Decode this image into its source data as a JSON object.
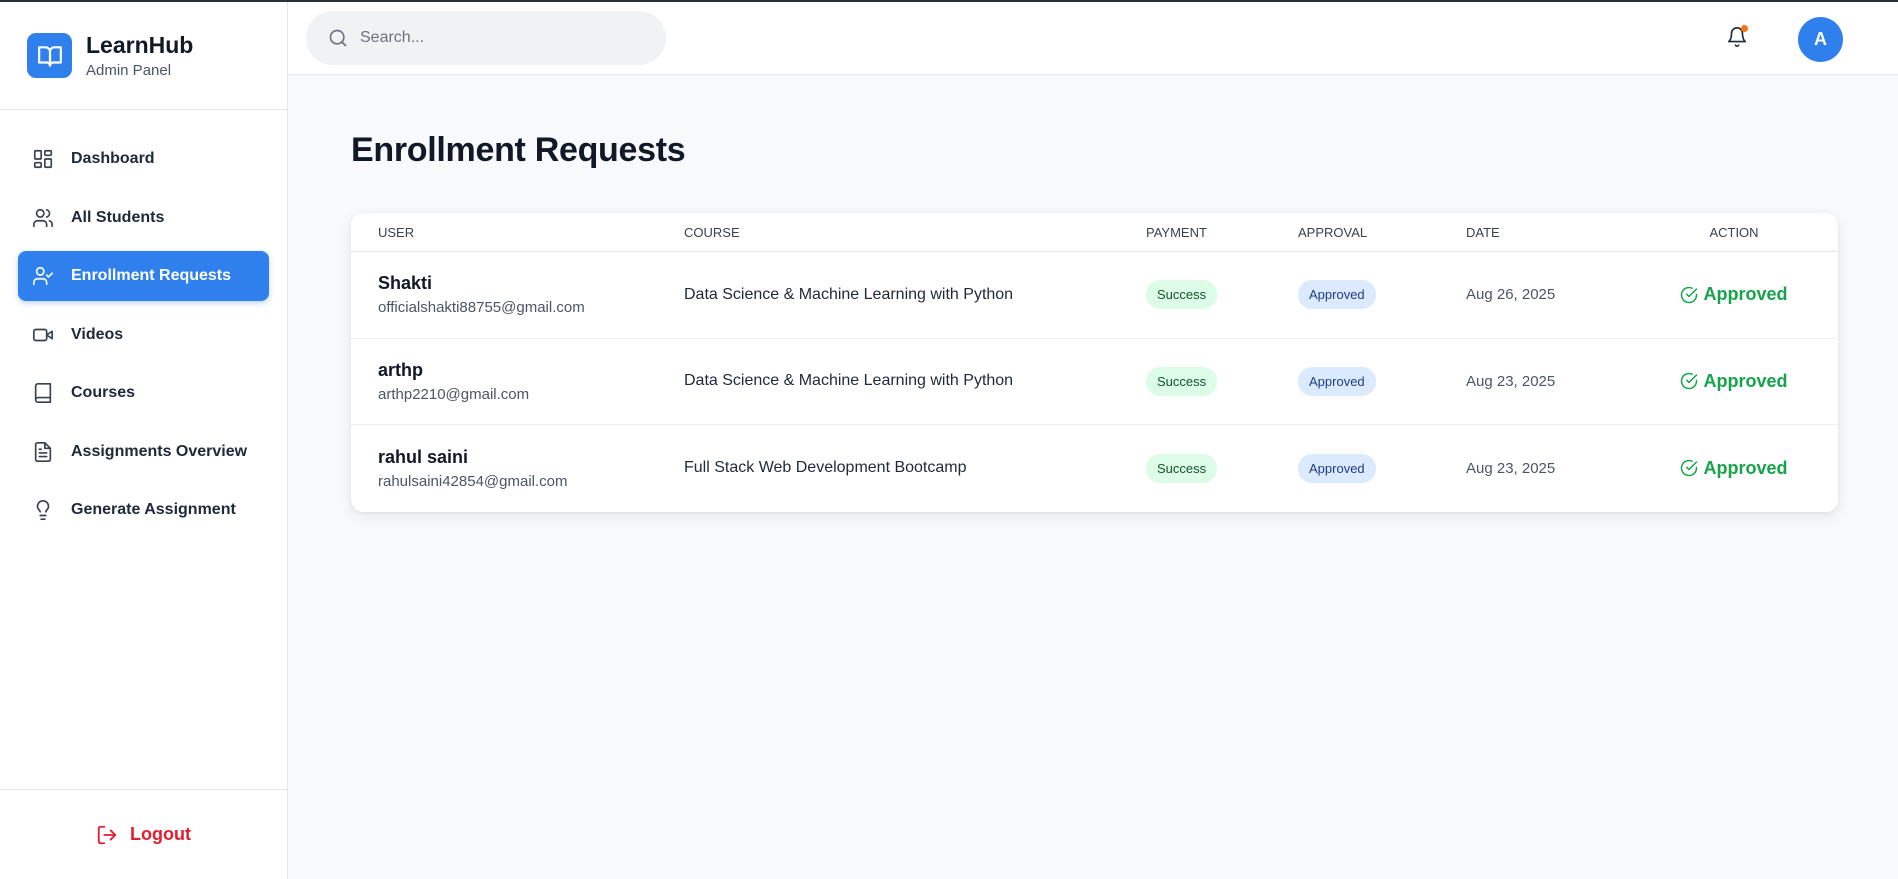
{
  "brand": {
    "name": "LearnHub",
    "subtitle": "Admin Panel",
    "accent_color": "#2f80ed"
  },
  "sidebar": {
    "items": [
      {
        "label": "Dashboard",
        "icon": "grid-icon",
        "active": false
      },
      {
        "label": "All Students",
        "icon": "users-icon",
        "active": false
      },
      {
        "label": "Enrollment Requests",
        "icon": "user-check-icon",
        "active": true
      },
      {
        "label": "Videos",
        "icon": "video-icon",
        "active": false
      },
      {
        "label": "Courses",
        "icon": "book-icon",
        "active": false
      },
      {
        "label": "Assignments Overview",
        "icon": "file-text-icon",
        "active": false
      },
      {
        "label": "Generate Assignment",
        "icon": "lightbulb-icon",
        "active": false
      }
    ],
    "logout_label": "Logout"
  },
  "topbar": {
    "search_placeholder": "Search...",
    "avatar_initial": "A",
    "notification_dot_color": "#f97316"
  },
  "main": {
    "title": "Enrollment Requests",
    "table": {
      "headers": {
        "user": "USER",
        "course": "COURSE",
        "payment": "PAYMENT",
        "approval": "APPROVAL",
        "date": "DATE",
        "action": "ACTION"
      },
      "rows": [
        {
          "name": "Shakti",
          "email": "officialshakti88755@gmail.com",
          "course": "Data Science & Machine Learning with Python",
          "payment": "Success",
          "approval": "Approved",
          "date": "Aug 26, 2025",
          "action": "Approved"
        },
        {
          "name": "arthp",
          "email": "arthp2210@gmail.com",
          "course": "Data Science & Machine Learning with Python",
          "payment": "Success",
          "approval": "Approved",
          "date": "Aug 23, 2025",
          "action": "Approved"
        },
        {
          "name": "rahul saini",
          "email": "rahulsaini42854@gmail.com",
          "course": "Full Stack Web Development Bootcamp",
          "payment": "Success",
          "approval": "Approved",
          "date": "Aug 23, 2025",
          "action": "Approved"
        }
      ]
    }
  }
}
